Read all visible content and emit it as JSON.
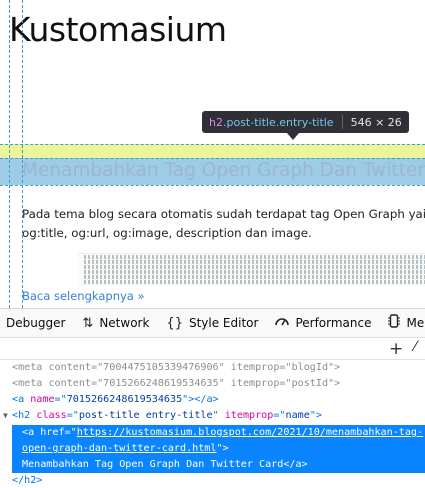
{
  "page": {
    "blog_title": "Kustomasium",
    "post_title": "Menambahkan Tag Open Graph Dan Twitter Card",
    "post_desc": "Pada tema blog secara otomatis sudah terdapat tag Open Graph yaitu og:title, og:url, og:image, description dan image.",
    "read_more": "Baca selengkapnya »"
  },
  "tooltip": {
    "tag": "h2",
    "classes": ".post-title.entry-title",
    "dimensions": "546 × 26"
  },
  "devtools": {
    "tabs": [
      {
        "label": "Debugger",
        "icon": "debugger-icon"
      },
      {
        "label": "Network",
        "icon": "network-icon"
      },
      {
        "label": "Style Editor",
        "icon": "style-editor-icon"
      },
      {
        "label": "Performance",
        "icon": "performance-icon"
      },
      {
        "label": "Memory",
        "icon": "memory-icon"
      }
    ],
    "markup": {
      "meta1": {
        "tag": "meta",
        "attr1": "content",
        "val1": "7004475105339476906",
        "attr2": "itemprop",
        "val2": "blogId"
      },
      "meta2": {
        "tag": "meta",
        "attr1": "content",
        "val1": "7015266248619534635",
        "attr2": "itemprop",
        "val2": "postId"
      },
      "anchor": {
        "tag": "a",
        "attr": "name",
        "val": "7015266248619534635"
      },
      "h2": {
        "tag": "h2",
        "attr1": "class",
        "val1": "post-title entry-title",
        "attr2": "itemprop",
        "val2": "name"
      },
      "link": {
        "href_line1": "https://kustomasium.blogspot.com/2021/10/menambahkan-tag-",
        "href_line2": "open-graph-dan-twitter-card.html",
        "text": "Menambahkan Tag Open Graph Dan Twitter Card"
      },
      "close_h2": "</h2>"
    }
  },
  "colors": {
    "highlight_content": "#7ebade",
    "highlight_margin": "#edf59a",
    "selection": "#0a84ff",
    "tag": "#0074e8",
    "attr_name": "#dd00a9",
    "attr_value": "#003eaa"
  }
}
